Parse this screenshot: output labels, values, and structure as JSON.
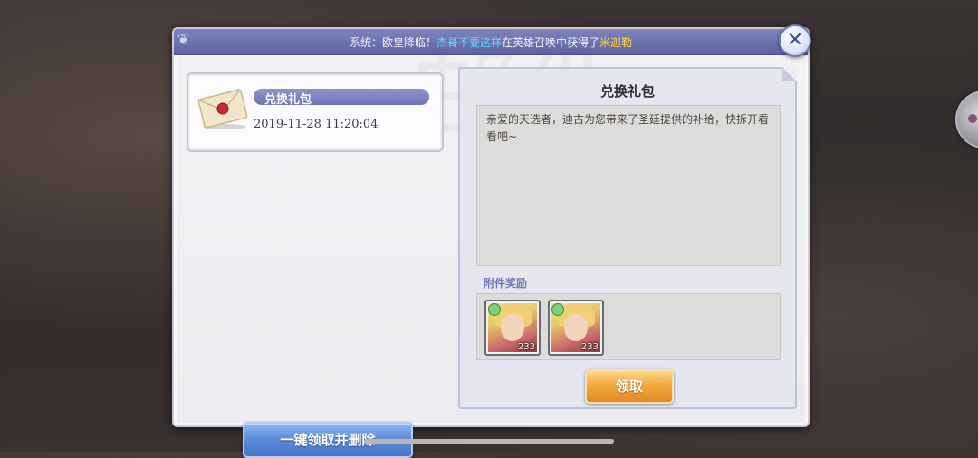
{
  "system_notice": {
    "prefix": "系统：欧皇降临！",
    "player_name": "杰哥不要这样",
    "middle": "在英雄召唤中获得了",
    "hero_name": "米迦勒"
  },
  "panel_title_watermark": "邮件",
  "mail_list": [
    {
      "title": "兑换礼包",
      "date": "2019-11-28 11:20:04",
      "icon": "envelope-icon"
    }
  ],
  "claim_all_delete_label": "一键领取并删除",
  "mail_detail": {
    "heading": "兑换礼包",
    "body": "亲爱的天选者，迪古为您带来了圣廷提供的补给，快拆开看看吧~",
    "attachment_label": "附件奖励",
    "rewards": [
      {
        "quantity": "233",
        "icon": "hero-portrait-icon"
      },
      {
        "quantity": "233",
        "icon": "hero-portrait-icon"
      }
    ],
    "claim_label": "领取"
  },
  "colors": {
    "topbar": "#6a70ae",
    "player_name": "#5fd6ff",
    "hero_name": "#ffd84a",
    "claim_button": "#f0a53a",
    "claim_all_button": "#5a88d8"
  }
}
